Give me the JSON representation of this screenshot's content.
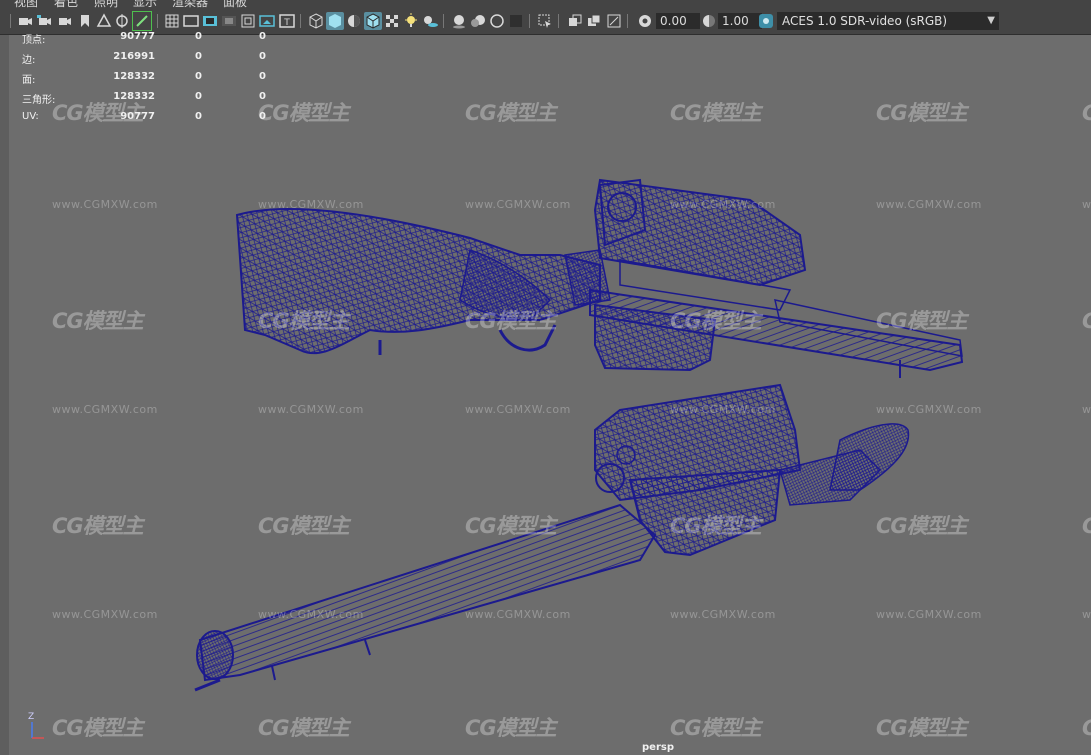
{
  "menus": [
    "视图",
    "着色",
    "照明",
    "显示",
    "渲染器",
    "面板"
  ],
  "toolbar": {
    "exposure": "0.00",
    "gamma": "1.00",
    "color_management": "ACES 1.0 SDR-video (sRGB)"
  },
  "hud": {
    "rows": [
      {
        "label": "顶点:",
        "v1": "90777",
        "v2": "0",
        "v3": "0"
      },
      {
        "label": "边:",
        "v1": "216991",
        "v2": "0",
        "v3": "0"
      },
      {
        "label": "面:",
        "v1": "128332",
        "v2": "0",
        "v3": "0"
      },
      {
        "label": "三角形:",
        "v1": "128332",
        "v2": "0",
        "v3": "0"
      },
      {
        "label": "UV:",
        "v1": "90777",
        "v2": "0",
        "v3": "0"
      }
    ]
  },
  "camera_label": "persp",
  "axis_label": "Z",
  "watermark": {
    "logo": "CG模型主",
    "url": "www.CGMXW.com"
  },
  "colors": {
    "wire": "#1c1a8e",
    "viewport": "#6d6d6d",
    "toolbar": "#444444"
  }
}
